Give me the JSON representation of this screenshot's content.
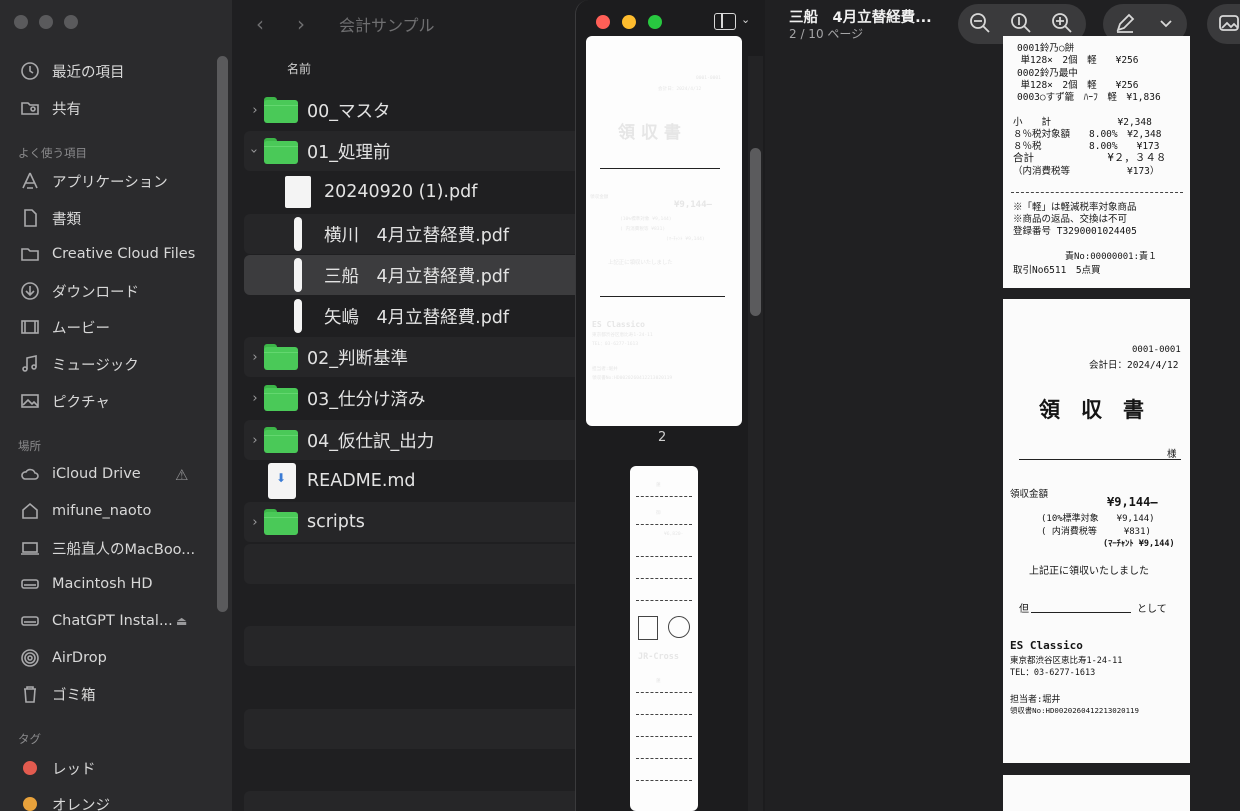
{
  "finder": {
    "window_title": "会計サンプル",
    "column_header": "名前",
    "sidebar": {
      "favorites_header": "よく使う項目",
      "locations_header": "場所",
      "tags_header": "タグ",
      "top_items": [
        {
          "label": "最近の項目",
          "icon": "clock-icon"
        },
        {
          "label": "共有",
          "icon": "shared-folder-icon"
        }
      ],
      "favorites": [
        {
          "label": "アプリケーション",
          "icon": "applications-icon"
        },
        {
          "label": "書類",
          "icon": "document-icon"
        },
        {
          "label": "Creative Cloud Files",
          "icon": "folder-icon"
        },
        {
          "label": "ダウンロード",
          "icon": "download-icon"
        },
        {
          "label": "ムービー",
          "icon": "film-icon"
        },
        {
          "label": "ミュージック",
          "icon": "music-icon"
        },
        {
          "label": "ピクチャ",
          "icon": "picture-icon"
        }
      ],
      "locations": [
        {
          "label": "iCloud Drive",
          "icon": "cloud-icon"
        },
        {
          "label": "mifune_naoto",
          "icon": "home-icon"
        },
        {
          "label": "三船直人のMacBoo...",
          "icon": "laptop-icon"
        },
        {
          "label": "Macintosh HD",
          "icon": "drive-icon"
        },
        {
          "label": "ChatGPT Instal...",
          "icon": "drive-icon"
        },
        {
          "label": "AirDrop",
          "icon": "airdrop-icon"
        },
        {
          "label": "ゴミ箱",
          "icon": "trash-icon"
        }
      ],
      "tags": [
        {
          "label": "レッド",
          "color": "#e25b4f"
        },
        {
          "label": "オレンジ",
          "color": "#e9a23b"
        }
      ]
    },
    "rows": [
      {
        "name": "00_マスタ",
        "kind": "folder",
        "expanded": false
      },
      {
        "name": "01_処理前",
        "kind": "folder",
        "expanded": true
      },
      {
        "name": "20240920 (1).pdf",
        "kind": "pdf-thumb"
      },
      {
        "name": "横川　4月立替経費.pdf",
        "kind": "pdf"
      },
      {
        "name": "三船　4月立替経費.pdf",
        "kind": "pdf",
        "selected": true
      },
      {
        "name": "矢嶋　4月立替経費.pdf",
        "kind": "pdf"
      },
      {
        "name": "02_判断基準",
        "kind": "folder",
        "expanded": false
      },
      {
        "name": "03_仕分け済み",
        "kind": "folder",
        "expanded": false
      },
      {
        "name": "04_仮仕訳_出力",
        "kind": "folder",
        "expanded": false
      },
      {
        "name": "README.md",
        "kind": "markdown"
      },
      {
        "name": "scripts",
        "kind": "folder",
        "expanded": false
      }
    ]
  },
  "preview": {
    "doc_title": "三船　4月立替経費...",
    "page_indicator": "2 / 10 ページ",
    "thumb_page_number": "2",
    "thumb2": {
      "title": "領 収 書",
      "jr_cross": "JR-Cross"
    },
    "receipt_top": {
      "lines": [
        "0001鈴乃○餅",
        "　単128×　2個　軽　　¥256",
        "0002鈴乃最中",
        "　単128×　2個　軽　　¥256",
        "0003○すず籠　ﾊｰﾌ　軽　¥1,836",
        "小　　計　　　　　　　¥2,348",
        "８％税対象額　　8.00%　¥2,348",
        "８％税　　　　　8.00%　　¥173",
        "合計　　　　　　　¥２，３４８",
        "（内消費税等　　　　　　¥173）",
        "※「軽」は軽減税率対象商品",
        "※商品の返品、交換は不可",
        "登録番号 T3290001024405",
        "責No:00000001:責１",
        "取引No6511　5点買"
      ]
    },
    "receipt_main": {
      "serial": "0001-0001",
      "accounting_date": "会計日：2024/4/12",
      "title": "領　収　書",
      "honorific": "様",
      "amount_label": "領収金額",
      "amount": "¥9,144—",
      "tax_target": "(10%標準対象　　¥9,144)",
      "tax_included": "( 内消費税等　　　¥831)",
      "merchant_total": "(ﾏｰﾁｬﾝﾄ ¥9,144)",
      "received": "上記正に領収いたしました",
      "for_prefix": "但",
      "for_suffix": "として",
      "shop": "ES Classico",
      "address": "東京都渋谷区恵比寿1-24-11",
      "tel": "TEL：03-6277-1613",
      "staff": "担当者:堀井",
      "receipt_no": "領収書No:HD0020260412213020119"
    }
  }
}
